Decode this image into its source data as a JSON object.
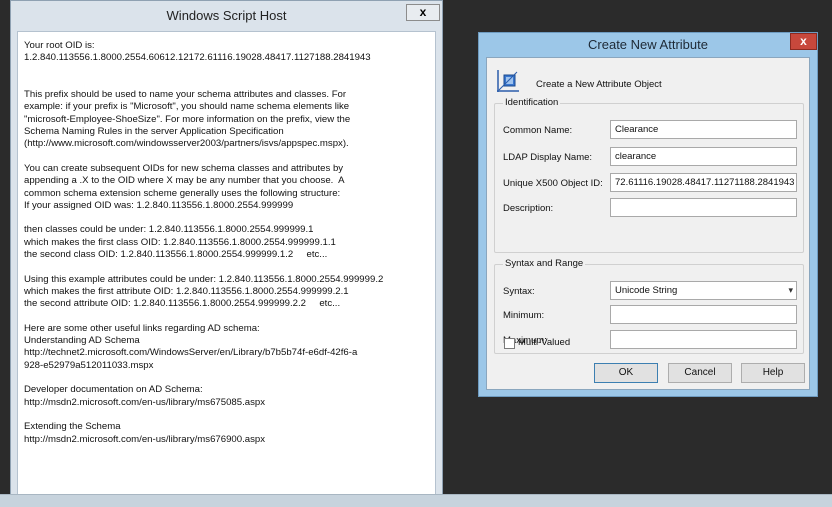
{
  "wsh": {
    "title": "Windows Script Host",
    "close_label": "x",
    "lines": [
      "Your root OID is:",
      "1.2.840.113556.1.8000.2554.60612.12172.61116.19028.48417.1127188.2841943",
      "",
      "",
      "This prefix should be used to name your schema attributes and classes. For",
      "example: if your prefix is \"Microsoft\", you should name schema elements like",
      "\"microsoft-Employee-ShoeSize\". For more information on the prefix, view the",
      "Schema Naming Rules in the server Application Specification",
      "(http://www.microsoft.com/windowsserver2003/partners/isvs/appspec.mspx).",
      "",
      "You can create subsequent OIDs for new schema classes and attributes by",
      "appending a .X to the OID where X may be any number that you choose.  A",
      "common schema extension scheme generally uses the following structure:",
      "If your assigned OID was: 1.2.840.113556.1.8000.2554.999999",
      "",
      "then classes could be under: 1.2.840.113556.1.8000.2554.999999.1",
      "which makes the first class OID: 1.2.840.113556.1.8000.2554.999999.1.1",
      "the second class OID: 1.2.840.113556.1.8000.2554.999999.1.2     etc...",
      "",
      "Using this example attributes could be under: 1.2.840.113556.1.8000.2554.999999.2",
      "which makes the first attribute OID: 1.2.840.113556.1.8000.2554.999999.2.1",
      "the second attribute OID: 1.2.840.113556.1.8000.2554.999999.2.2     etc...",
      "",
      "Here are some other useful links regarding AD schema:",
      "Understanding AD Schema",
      "http://technet2.microsoft.com/WindowsServer/en/Library/b7b5b74f-e6df-42f6-a",
      "928-e52979a512011033.mspx",
      "",
      "Developer documentation on AD Schema:",
      "http://msdn2.microsoft.com/en-us/library/ms675085.aspx",
      "",
      "Extending the Schema",
      "http://msdn2.microsoft.com/en-us/library/ms676900.aspx"
    ]
  },
  "dialog": {
    "title": "Create New Attribute",
    "close_label": "x",
    "header_label": "Create a New Attribute Object",
    "identification": {
      "group_label": "Identification",
      "common_name_label": "Common Name:",
      "common_name_value": "Clearance",
      "ldap_label": "LDAP Display Name:",
      "ldap_value": "clearance",
      "oid_label": "Unique X500 Object ID:",
      "oid_value": "72.61116.19028.48417.11271188.2841943",
      "description_label": "Description:",
      "description_value": ""
    },
    "syntax_range": {
      "group_label": "Syntax and Range",
      "syntax_label": "Syntax:",
      "syntax_value": "Unicode String",
      "minimum_label": "Minimum:",
      "minimum_value": "",
      "maximum_label": "Maximum:",
      "maximum_value": ""
    },
    "multivalued_label": "Multi-Valued",
    "ok_label": "OK",
    "cancel_label": "Cancel",
    "help_label": "Help"
  }
}
